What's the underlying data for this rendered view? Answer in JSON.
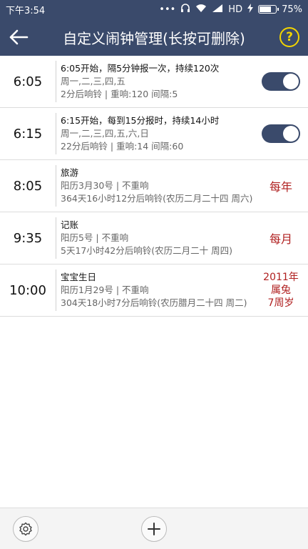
{
  "status_bar": {
    "time": "下午3:54",
    "network": "HD",
    "battery": "75%",
    "battery_level": 0.75
  },
  "app_bar": {
    "title": "自定义闹钟管理(长按可删除)",
    "help_label": "?"
  },
  "alarms": [
    {
      "time": "6:05",
      "line1": "6:05开始，隔5分钟报一次，持续120次",
      "line2": "周一,二,三,四,五",
      "line3": "2分后响铃 | 重响:120  间隔:5",
      "enabled": true
    },
    {
      "time": "6:15",
      "line1": "6:15开始，每到15分报时，持续14小时",
      "line2": "周一,二,三,四,五,六,日",
      "line3": "22分后响铃 | 重响:14  间隔:60",
      "enabled": true
    },
    {
      "time": "8:05",
      "line1": "旅游",
      "line2": "阳历3月30号 | 不重响",
      "line3": "364天16小时12分后响铃(农历二月二十四 周六)",
      "repeat": "每年"
    },
    {
      "time": "9:35",
      "line1": "记账",
      "line2": "阳历5号 | 不重响",
      "line3": "5天17小时42分后响铃(农历二月二十 周四)",
      "repeat": "每月"
    },
    {
      "time": "10:00",
      "line1": "宝宝生日",
      "line2": "阳历1月29号 | 不重响",
      "line3": "304天18小时7分后响铃(农历腊月二十四 周二)",
      "repeat_lines": [
        "2011年",
        "属兔",
        "7周岁"
      ]
    }
  ],
  "colors": {
    "primary": "#3a4a6b",
    "accent_red": "#b02020",
    "help_yellow": "#f2d400"
  },
  "icons": {
    "back": "back-arrow-icon",
    "help": "help-icon",
    "settings": "gear-icon",
    "add": "plus-icon"
  }
}
